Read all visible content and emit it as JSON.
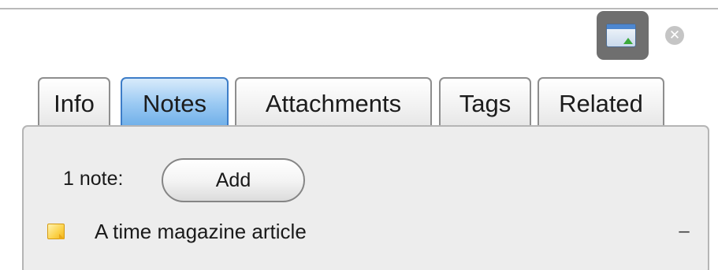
{
  "toolbar": {
    "window_icon": "window-upload-icon",
    "close_icon": "close-circle-icon",
    "close_glyph": "✕"
  },
  "tabs": [
    {
      "label": "Info",
      "active": false
    },
    {
      "label": "Notes",
      "active": true
    },
    {
      "label": "Attachments",
      "active": false
    },
    {
      "label": "Tags",
      "active": false
    },
    {
      "label": "Related",
      "active": false
    }
  ],
  "notes": {
    "count_label": "1 note:",
    "add_label": "Add",
    "items": [
      {
        "icon": "note-icon",
        "title": "A time magazine article",
        "remove_label": "–"
      }
    ]
  },
  "colors": {
    "active_tab": "#6daee8",
    "panel_bg": "#ededed",
    "note_icon": "#fbd24b"
  }
}
